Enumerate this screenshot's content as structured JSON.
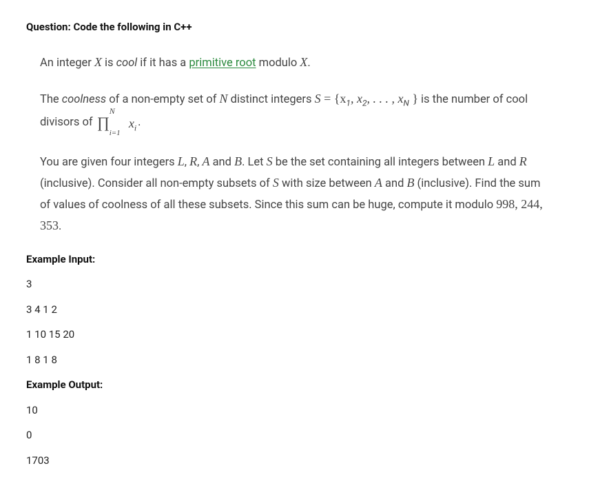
{
  "header": {
    "label": "Question:",
    "text": "Code the following in C++"
  },
  "problem": {
    "p1_pre": "An integer ",
    "p1_x": "X",
    "p1_mid1": " is ",
    "p1_cool": "cool",
    "p1_mid2": " if it has a ",
    "p1_link": "primitive root",
    "p1_mid3": " modulo ",
    "p1_x2": "X",
    "p1_end": ".",
    "p2_pre": "The ",
    "p2_coolness": "coolness",
    "p2_mid1": " of a non-empty set of ",
    "p2_n": "N",
    "p2_mid2": " distinct integers ",
    "p2_s": "S",
    "p2_eq": " = ",
    "p2_set": "{x",
    "p2_s1": "1",
    "p2_c1": ", x",
    "p2_s2": "2",
    "p2_dots": ", . . . , x",
    "p2_sn": "N",
    "p2_setend": " }",
    "p2_mid3": " is the number of cool divisors of ",
    "p2_prod_sup": "N",
    "p2_prod_sub": "i=1",
    "p2_prod_term_x": "x",
    "p2_prod_term_i": "i",
    "p2_end": ".",
    "p3_pre": "You are given four integers ",
    "p3_l": "L",
    "p3_c1": ", ",
    "p3_r": "R",
    "p3_c2": ", ",
    "p3_a": "A",
    "p3_and": " and ",
    "p3_b": "B",
    "p3_mid1": ". Let ",
    "p3_s": "S",
    "p3_mid2": " be the set containing all integers between ",
    "p3_l2": "L",
    "p3_and2": " and ",
    "p3_r2": "R",
    "p3_mid3": " (inclusive). Consider all non-empty subsets of ",
    "p3_s2": "S",
    "p3_mid4": " with size between ",
    "p3_a2": "A",
    "p3_and3": " and ",
    "p3_b2": "B",
    "p3_mid5": " (inclusive). Find the sum of values of coolness of all these subsets. Since this sum can be huge, compute it modulo ",
    "p3_mod": "998, 244, 353",
    "p3_end": "."
  },
  "io": {
    "input_label": "Example Input:",
    "output_label": "Example Output:",
    "inputs": [
      "3",
      "3 4 1 2",
      "1 10 15 20",
      "1 8 1 8"
    ],
    "outputs": [
      "10",
      "0",
      "1703"
    ]
  }
}
